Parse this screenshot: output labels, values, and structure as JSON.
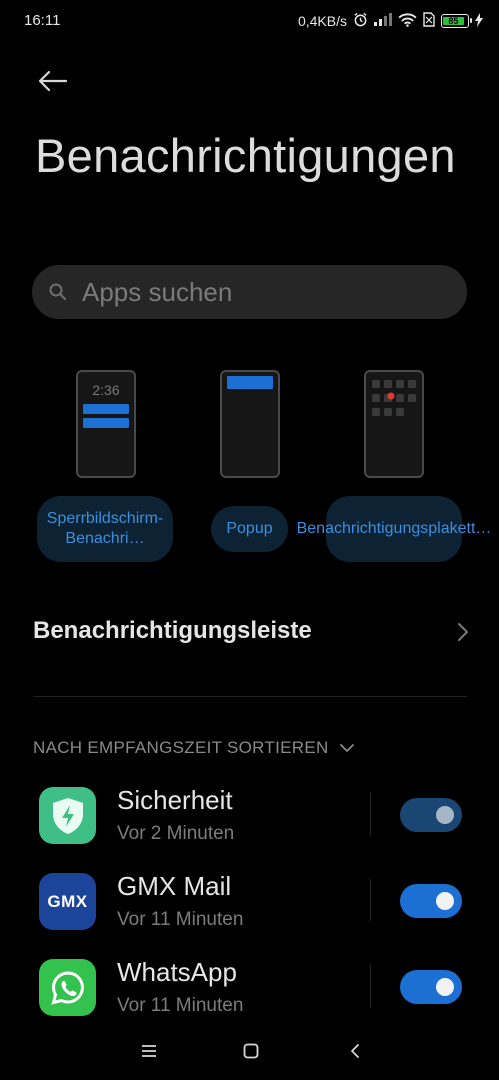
{
  "status_bar": {
    "time": "16:11",
    "network_speed": "0,4KB/s",
    "battery": "85"
  },
  "page": {
    "title": "Benachrichtigungen",
    "search_placeholder": "Apps suchen"
  },
  "styles": {
    "lock_clock": "2:36",
    "buttons": [
      {
        "label": "Sperrbildschirm-Benachri…"
      },
      {
        "label": "Popup"
      },
      {
        "label": "Benachrichtigungsplakett…"
      }
    ]
  },
  "notification_shade": {
    "label": "Benachrichtigungsleiste"
  },
  "sort": {
    "label": "NACH EMPFANGSZEIT SORTIEREN"
  },
  "apps": [
    {
      "name": "Sicherheit",
      "time": "Vor 2 Minuten",
      "enabled": true,
      "icon": "shield-icon",
      "color": "#3fbf86"
    },
    {
      "name": "GMX Mail",
      "time": "Vor 11 Minuten",
      "enabled": true,
      "icon": "gmx-icon",
      "icon_text": "GMX",
      "color": "#1c449b"
    },
    {
      "name": "WhatsApp",
      "time": "Vor 11 Minuten",
      "enabled": true,
      "icon": "whatsapp-icon",
      "color": "#33c24d"
    }
  ],
  "colors": {
    "accent": "#1c70d4",
    "accent_text": "#3b8fe0",
    "background": "#000000"
  }
}
